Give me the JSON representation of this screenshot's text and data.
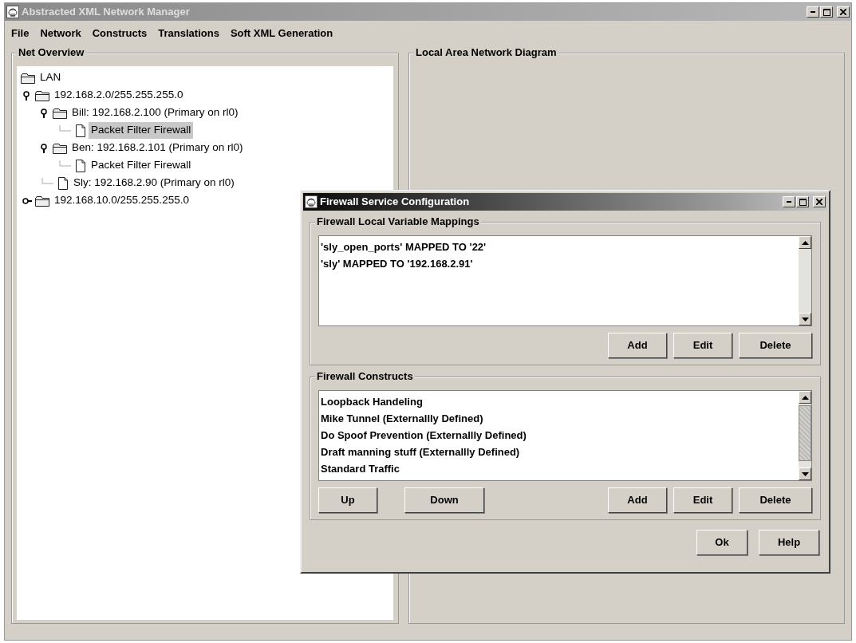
{
  "window": {
    "title": "Abstracted XML Network Manager",
    "active": false
  },
  "menu": [
    {
      "label": "File"
    },
    {
      "label": "Network"
    },
    {
      "label": "Constructs"
    },
    {
      "label": "Translations"
    },
    {
      "label": "Soft XML Generation"
    }
  ],
  "net_overview": {
    "title": "Net Overview",
    "tree": [
      {
        "label": "LAN",
        "kind": "folder",
        "selected": false,
        "children": [
          {
            "label": "192.168.2.0/255.255.255.0",
            "kind": "folder",
            "expanded": true,
            "selected": false,
            "children": [
              {
                "label": "Bill: 192.168.2.100 (Primary on rl0)",
                "kind": "folder",
                "expanded": true,
                "selected": false,
                "children": [
                  {
                    "label": "Packet Filter Firewall",
                    "kind": "file",
                    "selected": true
                  }
                ]
              },
              {
                "label": "Ben: 192.168.2.101 (Primary on rl0)",
                "kind": "folder",
                "expanded": true,
                "selected": false,
                "children": [
                  {
                    "label": "Packet Filter Firewall",
                    "kind": "file",
                    "selected": false
                  }
                ]
              },
              {
                "label": "Sly: 192.168.2.90 (Primary on rl0)",
                "kind": "file",
                "selected": false
              }
            ]
          },
          {
            "label": "192.168.10.0/255.255.255.0",
            "kind": "folder",
            "expanded": false,
            "selected": false
          }
        ]
      }
    ]
  },
  "diagram": {
    "title": "Local Area Network Diagram"
  },
  "dialog": {
    "title": "Firewall Service Configuration",
    "active": true,
    "mappings": {
      "title": "Firewall Local Variable Mappings",
      "items": [
        "'sly_open_ports' MAPPED TO '22'",
        "'sly' MAPPED TO '192.168.2.91'"
      ],
      "buttons": [
        "Add",
        "Edit",
        "Delete"
      ]
    },
    "constructs": {
      "title": "Firewall Constructs",
      "items": [
        "Loopback Handeling",
        "Mike Tunnel (Externallly Defined)",
        "Do Spoof Prevention (Externallly Defined)",
        "Draft manning stuff (Externallly Defined)",
        "Standard Traffic"
      ],
      "left_buttons": [
        "Up",
        "Down"
      ],
      "buttons": [
        "Add",
        "Edit",
        "Delete"
      ]
    },
    "buttons": [
      "Ok",
      "Help"
    ]
  }
}
